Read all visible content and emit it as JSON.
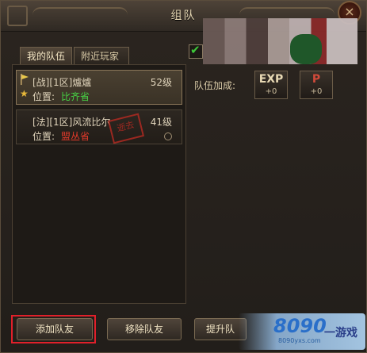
{
  "window": {
    "title": "组队",
    "close_symbol": "×"
  },
  "tabs": [
    {
      "label": "我的队伍",
      "active": true
    },
    {
      "label": "附近玩家",
      "active": false
    }
  ],
  "auto_accept_checkbox": {
    "checked": true
  },
  "members": [
    {
      "name": "[战][1区]爐爐",
      "level": "52级",
      "location_label": "位置:",
      "location": "比齐省",
      "location_color": "#46d244",
      "leader": true
    },
    {
      "name": "[法][1区]风流比尔",
      "level": "41级",
      "location_label": "位置:",
      "location": "盟丛省",
      "location_color": "#e23a2a",
      "leader": false,
      "stamp": "逝去"
    }
  ],
  "team_bonus": {
    "label": "队伍加成:",
    "items": [
      {
        "name": "EXP",
        "value": "+0"
      },
      {
        "name": "P",
        "value": "+0"
      }
    ]
  },
  "buttons": {
    "add": "添加队友",
    "remove": "移除队友",
    "promote": "提升队"
  },
  "watermark": {
    "number": "8090",
    "site": "8090yxs.com",
    "text": "一游戏"
  },
  "colors": {
    "highlight": "#e0202a",
    "accent": "#e8d9b4"
  }
}
